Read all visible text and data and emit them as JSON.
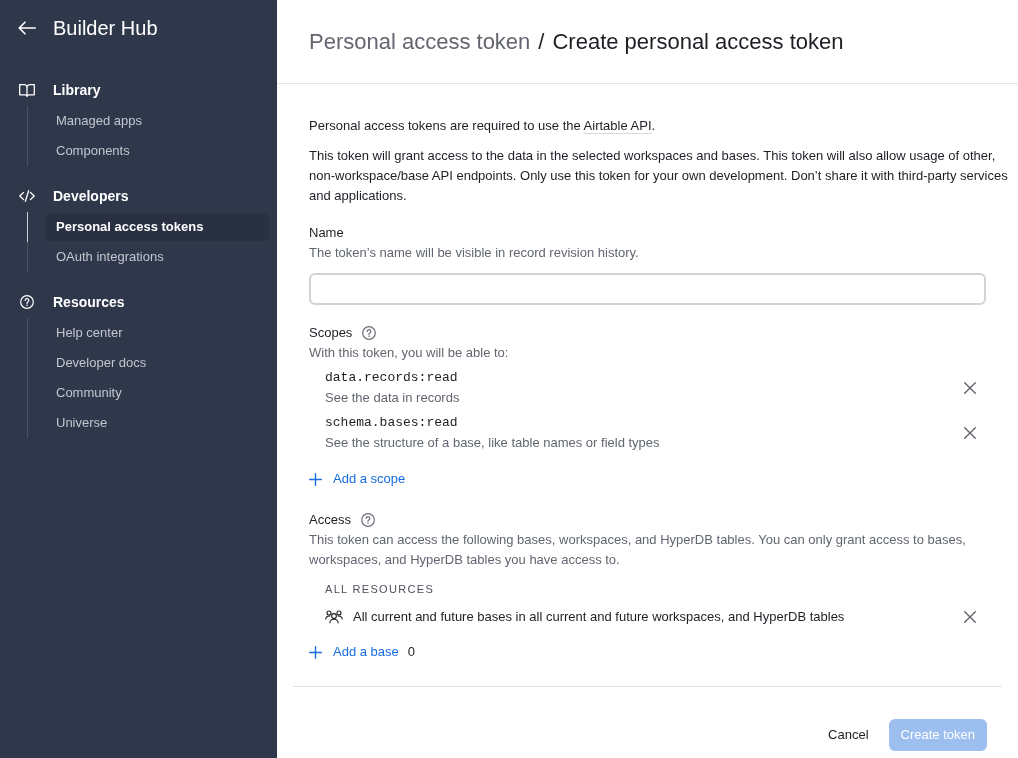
{
  "sidebar": {
    "title": "Builder Hub",
    "sections": [
      {
        "title": "Library",
        "items": [
          {
            "label": "Managed apps",
            "selected": false
          },
          {
            "label": "Components",
            "selected": false
          }
        ]
      },
      {
        "title": "Developers",
        "items": [
          {
            "label": "Personal access tokens",
            "selected": true
          },
          {
            "label": "OAuth integrations",
            "selected": false
          }
        ]
      },
      {
        "title": "Resources",
        "items": [
          {
            "label": "Help center",
            "selected": false
          },
          {
            "label": "Developer docs",
            "selected": false
          },
          {
            "label": "Community",
            "selected": false
          },
          {
            "label": "Universe",
            "selected": false
          }
        ]
      }
    ]
  },
  "header": {
    "breadcrumb": "Personal access token",
    "separator": "/",
    "title": "Create personal access token"
  },
  "intro": {
    "text": "Personal access tokens are required to use the ",
    "link": "Airtable API",
    "text_after": "."
  },
  "description": "This token will grant access to the data in the selected workspaces and bases. This token will also allow usage of other, non-workspace/base API endpoints. Only use this token for your own development. Don’t share it with third-party services and applications.",
  "name_field": {
    "label": "Name",
    "hint": "The token’s name will be visible in record revision history."
  },
  "scopes": {
    "label": "Scopes",
    "hint": "With this token, you will be able to:",
    "items": [
      {
        "code": "data.records:read",
        "description": "See the data in records"
      },
      {
        "code": "schema.bases:read",
        "description": "See the structure of a base, like table names or field types"
      }
    ],
    "add_label": "Add a scope"
  },
  "access": {
    "label": "Access",
    "hint": "This token can access the following bases, workspaces, and HyperDB tables. You can only grant access to bases, workspaces, and HyperDB tables you have access to.",
    "group_heading": "ALL RESOURCES",
    "items": [
      {
        "text": "All current and future bases in all current and future workspaces, and HyperDB tables"
      }
    ],
    "add_label": "Add a base",
    "count": "0"
  },
  "footer": {
    "buttons": [
      {
        "label": "Cancel",
        "kind": "secondary",
        "disabled": false
      },
      {
        "label": "Create token",
        "kind": "primary",
        "disabled": true
      }
    ]
  }
}
